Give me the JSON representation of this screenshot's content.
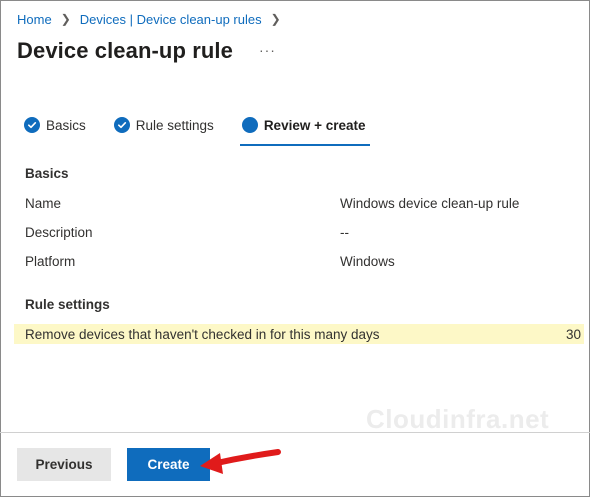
{
  "breadcrumb": {
    "home": "Home",
    "devices": "Devices | Device clean-up rules"
  },
  "page": {
    "title": "Device clean-up rule",
    "more": "···"
  },
  "steps": [
    {
      "label": "Basics",
      "state": "complete"
    },
    {
      "label": "Rule settings",
      "state": "complete"
    },
    {
      "label": "Review + create",
      "state": "current"
    }
  ],
  "review": {
    "basics_heading": "Basics",
    "name_label": "Name",
    "name_value": "Windows device clean-up rule",
    "description_label": "Description",
    "description_value": "--",
    "platform_label": "Platform",
    "platform_value": "Windows",
    "rule_heading": "Rule settings",
    "rule_label": "Remove devices that haven't checked in for this many days",
    "rule_value": "30"
  },
  "watermark": "Cloudinfra.net",
  "footer": {
    "previous_label": "Previous",
    "create_label": "Create"
  },
  "colors": {
    "accent": "#0f6cbd",
    "highlight": "#fdf8c7",
    "arrow": "#e01b1b"
  }
}
